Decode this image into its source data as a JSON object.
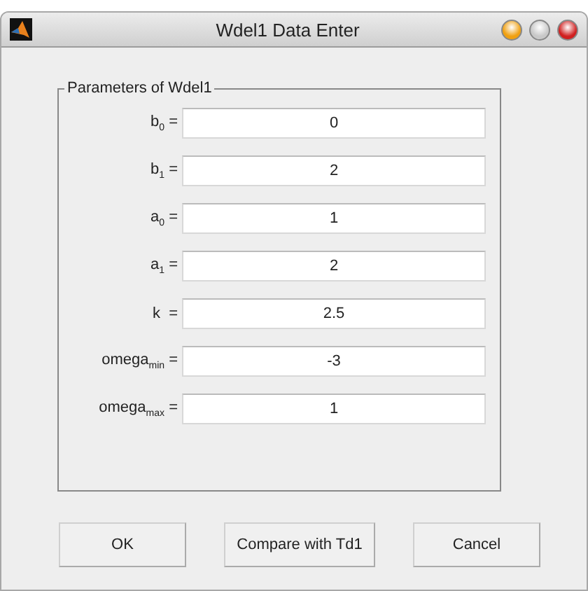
{
  "window": {
    "title": "Wdel1 Data Enter"
  },
  "panel": {
    "title": "Parameters of Wdel1",
    "fields": [
      {
        "label": "b$_{0}$ =",
        "value": "0"
      },
      {
        "label": "b$_{1}$ =",
        "value": "2"
      },
      {
        "label": "a$_{0}$ =",
        "value": "1"
      },
      {
        "label": "a$_{1}$ =",
        "value": "2"
      },
      {
        "label": "k  =",
        "value": "2.5"
      },
      {
        "label": "omega$_{min}$ =",
        "value": "-3"
      },
      {
        "label": "omega$_{max}$ =",
        "value": "1"
      }
    ]
  },
  "buttons": [
    "OK",
    "Compare with Td1",
    "Cancel"
  ]
}
